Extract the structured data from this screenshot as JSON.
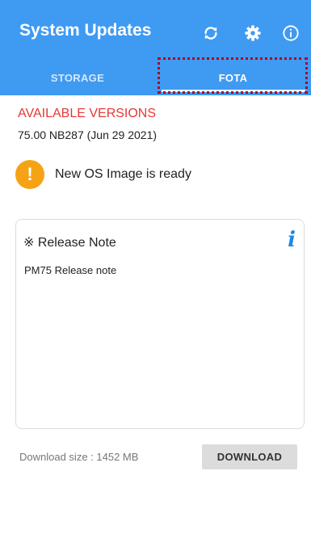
{
  "appbar": {
    "title": "System Updates",
    "actions": [
      "refresh-icon",
      "gear-icon",
      "info-icon"
    ],
    "color": "#3f9af2"
  },
  "tabs": [
    {
      "label": "STORAGE",
      "selected": false
    },
    {
      "label": "FOTA",
      "selected": true
    }
  ],
  "content": {
    "available_heading": "AVAILABLE VERSIONS",
    "version": "75.00 NB287 (Jun 29 2021)",
    "status_icon": "!",
    "status_text": "New OS Image is ready",
    "release_note": {
      "title": "※ Release Note",
      "info_icon": "i",
      "text": "PM75 Release note"
    },
    "download_size": "Download size : 1452 MB",
    "download_button": "DOWNLOAD"
  },
  "colors": {
    "accent": "#3f9af2",
    "heading_red": "#e53935",
    "warning_orange": "#f5a315",
    "info_blue": "#1e88e5"
  }
}
